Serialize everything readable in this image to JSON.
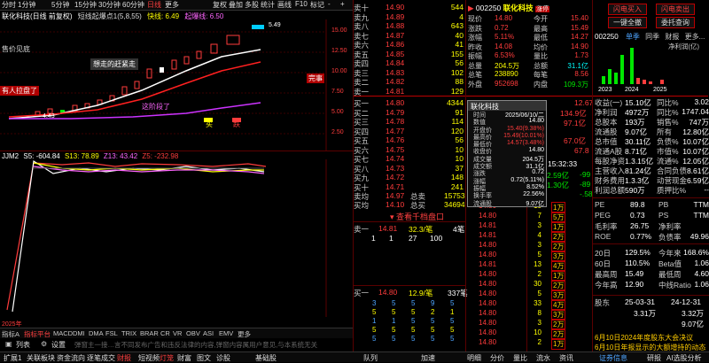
{
  "toolbar": {
    "items": [
      "分时",
      "1分钟",
      "5分钟",
      "15分钟",
      "30分钟",
      "60分钟",
      "日线",
      "更多"
    ],
    "right_items": [
      "复权",
      "叠加",
      "多股",
      "统计",
      "画线",
      "F10",
      "标记",
      "-",
      "+"
    ]
  },
  "chart_header": {
    "stock_label": "联化科技(日线 前复权)",
    "indicator": "短线起爆点1(5,8,55)",
    "kuaixian_label": "快线: 6.49",
    "kuaixian_value": "6.49",
    "manxian_label": "起爆线: 6.50"
  },
  "chart_annotations": {
    "buy_label": "售价见底",
    "profit_label": "有人拉盘了",
    "catchup_label": "想走的赶紧走",
    "wash_label": "这阶段了",
    "top_label": "完事",
    "price_peak": "5.49",
    "price_low": "4.43",
    "sell_label": "跌",
    "buy_char": "买",
    "y_ticks": [
      "15.00",
      "12.50",
      "10.00",
      "7.50",
      "5.00",
      "2.50"
    ]
  },
  "sub_chart": {
    "label": "JJM2",
    "s5": "S5: -604.84",
    "s13": "S13: 78.89",
    "z13": "Z13: 43.42",
    "z5": "Z5: -232.98",
    "year_label": "2025年"
  },
  "indicator_tabs": [
    "指标A",
    "指标平台",
    "MACD",
    "DMI",
    "DMA",
    "FSL",
    "TRIX",
    "BRAR",
    "CR",
    "VR",
    "OBV",
    "ASI",
    "EMV",
    "更多"
  ],
  "bottom_tools": [
    "列表",
    "设置"
  ],
  "disclaimer": "弹窗主一接…言不同发布广告和违反法律的内容,弹窗内容属用户意见,与本系统无关",
  "order_book": {
    "asks": [
      {
        "label": "卖十",
        "price": "14.90",
        "vol": "544"
      },
      {
        "label": "卖九",
        "price": "14.89",
        "vol": "4"
      },
      {
        "label": "卖八",
        "price": "14.88",
        "vol": "643"
      },
      {
        "label": "卖七",
        "price": "14.87",
        "vol": "40"
      },
      {
        "label": "卖六",
        "price": "14.86",
        "vol": "41"
      },
      {
        "label": "卖五",
        "price": "14.85",
        "vol": "155"
      },
      {
        "label": "卖四",
        "price": "14.84",
        "vol": "56"
      },
      {
        "label": "卖三",
        "price": "14.83",
        "vol": "102"
      },
      {
        "label": "卖二",
        "price": "14.82",
        "vol": "88"
      },
      {
        "label": "卖一",
        "price": "14.81",
        "vol": "129"
      }
    ],
    "bids": [
      {
        "label": "买一",
        "price": "14.80",
        "vol": "4344"
      },
      {
        "label": "买二",
        "price": "14.79",
        "vol": "91"
      },
      {
        "label": "买三",
        "price": "14.78",
        "vol": "114"
      },
      {
        "label": "买四",
        "price": "14.77",
        "vol": "120"
      },
      {
        "label": "买五",
        "price": "14.76",
        "vol": "56"
      },
      {
        "label": "买六",
        "price": "14.75",
        "vol": "10"
      },
      {
        "label": "买七",
        "price": "14.74",
        "vol": "10"
      },
      {
        "label": "买八",
        "price": "14.73",
        "vol": "37"
      },
      {
        "label": "买九",
        "price": "14.72",
        "vol": "148"
      },
      {
        "label": "买十",
        "price": "14.71",
        "vol": "241"
      }
    ],
    "avg_sell": {
      "label": "卖均",
      "price": "14.97",
      "total_label": "总卖",
      "total": "15753"
    },
    "avg_buy": {
      "label": "买均",
      "price": "14.10",
      "total_label": "总买",
      "total": "34694"
    },
    "view_queue_label": "查看千档盘口",
    "sell_queue_head": {
      "label": "卖一",
      "price": "14.81",
      "avg": "32.3/笔",
      "count": "4笔"
    },
    "sell_queue_vals": [
      "1",
      "1",
      "27",
      "100"
    ],
    "buy_queue_head": {
      "label": "买一",
      "price": "14.80",
      "avg": "12.9/笔",
      "count": "337笔"
    },
    "buy_queue_grid": [
      [
        "3",
        "5",
        "5",
        "9",
        "5"
      ],
      [
        "5",
        "5",
        "5",
        "2",
        "1"
      ],
      [
        "1",
        "1",
        "5",
        "5",
        "5"
      ],
      [
        "5",
        "5",
        "5",
        "5",
        "5"
      ],
      [
        "5",
        "5",
        "5",
        "5",
        "5"
      ]
    ],
    "tabs": [
      "队列",
      "加速"
    ]
  },
  "quote": {
    "code": "002250",
    "name": "联化科技",
    "badge": "涨停",
    "rows": [
      {
        "l1": "现价",
        "v1": "14.80",
        "l2": "今开",
        "v2": "15.40"
      },
      {
        "l1": "涨跌",
        "v1": "0.72",
        "l2": "最高",
        "v2": "15.49"
      },
      {
        "l1": "涨幅",
        "v1": "5.11%",
        "l2": "最低",
        "v2": "14.27"
      },
      {
        "l1": "昨收",
        "v1": "14.08",
        "l2": "均价",
        "v2": "14.90"
      },
      {
        "l1": "振幅",
        "v1": "6.53%",
        "l2": "量比",
        "v2": "1.73"
      },
      {
        "l1": "总量",
        "v1": "204.5万",
        "l2": "总额",
        "v2": "31.1亿"
      },
      {
        "l1": "总笔",
        "v1": "238890",
        "l2": "每笔",
        "v2": "8.56"
      },
      {
        "l1": "外盘",
        "v1": "952698",
        "l2": "内盘",
        "v2": "109.3万"
      }
    ]
  },
  "popup": {
    "title": "联化科技",
    "rows": [
      {
        "l": "时间",
        "v": "2025/06/10/二"
      },
      {
        "l": "数值",
        "v": "14.80"
      },
      {
        "l": "开盘价",
        "v": "15.40(9.38%)"
      },
      {
        "l": "最高价",
        "v": "15.49(10.01%)"
      },
      {
        "l": "最低价",
        "v": "14.57(3.48%)"
      },
      {
        "l": "收盘价",
        "v": "14.80"
      },
      {
        "l": "成交量",
        "v": "204.5万"
      },
      {
        "l": "成交额",
        "v": "31.1亿"
      },
      {
        "l": "涨跌",
        "v": "0.72"
      },
      {
        "l": "涨幅",
        "v": "0.72(5.11%)"
      },
      {
        "l": "振幅",
        "v": "8.52%"
      },
      {
        "l": "换手率",
        "v": "22.56%"
      },
      {
        "l": "流通股",
        "v": "9.07亿"
      }
    ]
  },
  "mid_right": {
    "values": [
      "12.67",
      "134.9亿",
      "97.1亿",
      "67.0亿",
      "67.8"
    ],
    "ticks": [
      {
        "t": "15:32:33",
        "p": "",
        "v": ""
      },
      {
        "t": "",
        "p": "2.59亿",
        "v": "-99"
      },
      {
        "t": "",
        "p": "1.30亿",
        "v": "-89"
      },
      {
        "t": "",
        "p": "",
        "v": "-.58"
      }
    ]
  },
  "trade_list": [
    {
      "p": "14.80",
      "v": "10",
      "f": "1万"
    },
    {
      "p": "14.80",
      "v": "7",
      "f": "5万"
    },
    {
      "p": "14.81",
      "v": "3",
      "f": "1万"
    },
    {
      "p": "14.81",
      "v": "4",
      "f": "2万"
    },
    {
      "p": "14.80",
      "v": "3",
      "f": "2万"
    },
    {
      "p": "14.80",
      "v": "5",
      "f": "3万"
    },
    {
      "p": "14.81",
      "v": "13",
      "f": "4万"
    },
    {
      "p": "14.80",
      "v": "2",
      "f": "1万"
    },
    {
      "p": "14.80",
      "v": "30",
      "f": "2万"
    },
    {
      "p": "14.80",
      "v": "5",
      "f": "3万"
    },
    {
      "p": "14.80",
      "v": "33",
      "f": "4万"
    },
    {
      "p": "14.80",
      "v": "8",
      "f": "3万"
    },
    {
      "p": "14.80",
      "v": "3",
      "f": "2万"
    },
    {
      "p": "14.80",
      "v": "10",
      "f": "2万"
    },
    {
      "p": "14.80",
      "v": "2",
      "f": "1万"
    }
  ],
  "right_panel": {
    "buttons": [
      "闪电买入",
      "闪电卖出",
      "一键全撤",
      "委托查询"
    ],
    "code": "002250",
    "tabs": [
      "单季",
      "同季",
      "财报",
      "更多..."
    ],
    "profit_label": "净利润(亿)",
    "years": [
      "2023",
      "2024",
      "2025"
    ],
    "fin": [
      {
        "l1": "收益(一)",
        "v1": "15.10亿",
        "l2": "同比%",
        "v2": "3.02"
      },
      {
        "l1": "净利润",
        "v1": "4972万",
        "l2": "同比%",
        "v2": "1747.04"
      },
      {
        "l1": "总股本",
        "v1": "193万",
        "l2": "销售%",
        "v2": "747万"
      },
      {
        "l1": "流通股",
        "v1": "9.07亿",
        "l2": "所有",
        "v2": "12.80亿"
      },
      {
        "l1": "总市值",
        "v1": "30.11亿",
        "l2": "负债%",
        "v2": "10.07亿"
      },
      {
        "l1": "流通A股",
        "v1": "8.71亿",
        "l2": "市值%",
        "v2": "10.07亿"
      },
      {
        "l1": "每股净资",
        "v1": "1.3.15亿",
        "l2": "流通%",
        "v2": "12.05亿"
      },
      {
        "l1": "主营收入",
        "v1": "81.24亿",
        "l2": "合同负债",
        "v2": "8.61亿"
      },
      {
        "l1": "财务费用",
        "v1": "1.3.3亿",
        "l2": "动营现金",
        "v2": "6.59亿"
      },
      {
        "l1": "利润总额",
        "v1": "590万",
        "l2": "质押比%",
        "v2": "--"
      }
    ],
    "ratios": [
      {
        "l1": "PE",
        "v1": "89.8",
        "l2": "PB",
        "v2": "TTM"
      },
      {
        "l1": "PEG",
        "v1": "0.73",
        "l2": "PS",
        "v2": "TTM"
      },
      {
        "l1": "毛利率",
        "v1": "26.75",
        "l2": "净利率",
        "v2": ""
      },
      {
        "l1": "ROE",
        "v1": "0.77%",
        "l2": "负债率",
        "v2": "49.96"
      }
    ],
    "stats": [
      {
        "l1": "20日",
        "v1": "129.5%",
        "l2": "今年来",
        "v2": "168.6%"
      },
      {
        "l1": "60日",
        "v1": "110.5%",
        "l2": "Beta值",
        "v2": "1.06"
      },
      {
        "l1": "最高周",
        "v1": "15.49",
        "l2": "最低周",
        "v2": "4.60"
      },
      {
        "l1": "今年高",
        "v1": "12.90",
        "l2": "中线Ratio",
        "v2": "1.06"
      }
    ],
    "holders": {
      "l": "股东",
      "d1": "25-03-31",
      "d2": "24-12-31",
      "v1": "3.31万",
      "v2": "3.32万",
      "v3": "9.07亿"
    },
    "news": "6月10日2024年度股东大会决议",
    "news2": "6月10日年报显示的大额增持的动态"
  },
  "bottom_status": {
    "tabs": [
      "扩展1",
      "关联板块",
      "资金流向",
      "逐笔成交",
      "财报",
      "短视频",
      "灯笼",
      "财富",
      "图文",
      "诊股"
    ],
    "right": [
      "基础股",
      "笔成交",
      "明细",
      "分价",
      "量比",
      "加速",
      "流水",
      "资讯",
      "账户",
      "证券信息",
      "研报",
      "AI选股分析"
    ]
  }
}
